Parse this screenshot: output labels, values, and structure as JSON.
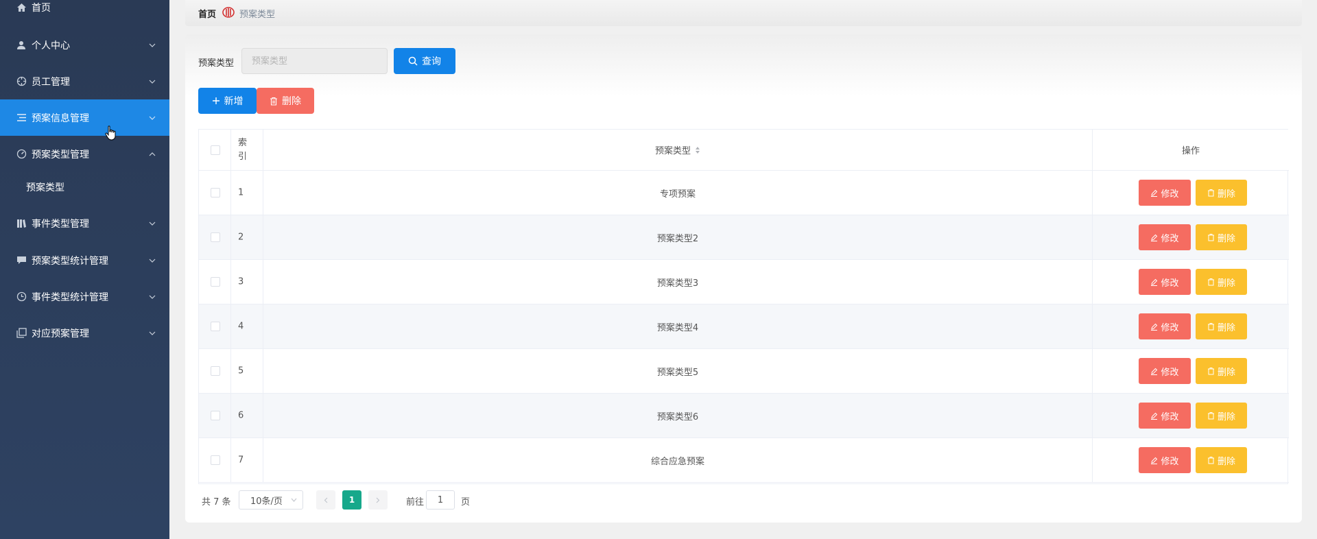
{
  "sidebar": {
    "items": [
      {
        "label": "首页",
        "icon": "home-icon"
      },
      {
        "label": "个人中心",
        "icon": "user-icon"
      },
      {
        "label": "员工管理",
        "icon": "crosshair-icon"
      },
      {
        "label": "预案信息管理",
        "icon": "list-icon"
      },
      {
        "label": "预案类型管理",
        "icon": "gauge-icon"
      },
      {
        "label": "事件类型管理",
        "icon": "books-icon"
      },
      {
        "label": "预案类型统计管理",
        "icon": "chat-icon"
      },
      {
        "label": "事件类型统计管理",
        "icon": "clock-icon"
      },
      {
        "label": "对应预案管理",
        "icon": "copy-icon"
      }
    ],
    "submenu": [
      {
        "label": "预案类型"
      }
    ],
    "active": "预案信息管理",
    "accent": "#1e88e5"
  },
  "breadcrumb": {
    "home": "首页",
    "current": "预案类型"
  },
  "search": {
    "label": "预案类型",
    "placeholder": "预案类型",
    "query_label": "查询"
  },
  "toolbar": {
    "add_label": "新增",
    "delete_label": "删除"
  },
  "table": {
    "headers": {
      "index": "索引",
      "type": "预案类型",
      "ops": "操作"
    },
    "rows": [
      {
        "index": "1",
        "type": "专项预案"
      },
      {
        "index": "2",
        "type": "预案类型2"
      },
      {
        "index": "3",
        "type": "预案类型3"
      },
      {
        "index": "4",
        "type": "预案类型4"
      },
      {
        "index": "5",
        "type": "预案类型5"
      },
      {
        "index": "6",
        "type": "预案类型6"
      },
      {
        "index": "7",
        "type": "综合应急预案"
      }
    ],
    "edit_label": "修改",
    "remove_label": "删除"
  },
  "pagination": {
    "total": "共 7 条",
    "page_size": "10条/页",
    "current_page": "1",
    "goto_label": "前往",
    "goto_value": "1",
    "page_suffix": "页"
  },
  "colors": {
    "primary": "#1283e8",
    "danger": "#f56c61",
    "warning": "#fbc02d",
    "page_active": "#17a88b"
  }
}
